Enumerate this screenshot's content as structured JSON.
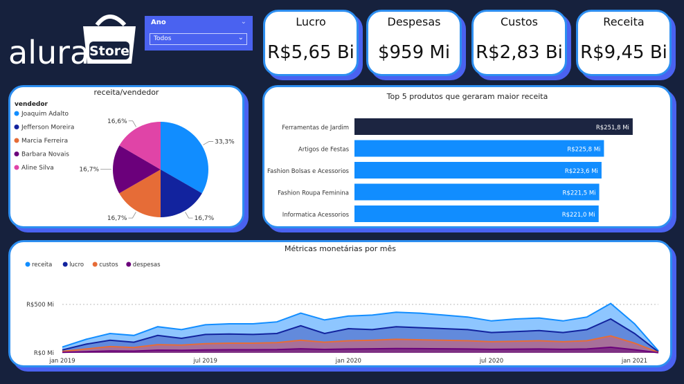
{
  "brand": {
    "name": "alura",
    "store": "Store"
  },
  "slicer": {
    "label": "Ano",
    "value": "Todos"
  },
  "kpis": [
    {
      "title": "Lucro",
      "value": "R$5,65 Bi"
    },
    {
      "title": "Despesas",
      "value": "$959 Mi"
    },
    {
      "title": "Custos",
      "value": "R$2,83 Bi"
    },
    {
      "title": "Receita",
      "value": "R$9,45 Bi"
    }
  ],
  "colors": {
    "background": "#16213d",
    "card_border": "#2d8ef0",
    "card_shadow": "#4a62f0",
    "slicer": "#4a62f0"
  },
  "chart_data": [
    {
      "type": "pie",
      "title": "receita/vendedor",
      "legend_title": "vendedor",
      "legend_position": "left",
      "slices": [
        {
          "name": "Joaquim Adalto",
          "value": 33.3,
          "label": "33,3%",
          "color": "#118dff"
        },
        {
          "name": "Jefferson Moreira",
          "value": 16.7,
          "label": "16,7%",
          "color": "#12239e"
        },
        {
          "name": "Marcia Ferreira",
          "value": 16.7,
          "label": "16,7%",
          "color": "#e66c37"
        },
        {
          "name": "Barbara Novais",
          "value": 16.7,
          "label": "16,7%",
          "color": "#6b007b"
        },
        {
          "name": "Aline Silva",
          "value": 16.6,
          "label": "16,6%",
          "color": "#e044a7"
        }
      ]
    },
    {
      "type": "bar",
      "orientation": "horizontal",
      "title": "Top 5 produtos que geraram maior receita",
      "categories": [
        "Ferramentas de Jardim",
        "Artigos de Festas",
        "Fashion Bolsas e Acessorios",
        "Fashion Roupa Feminina",
        "Informatica Acessorios"
      ],
      "values": [
        251.8,
        225.8,
        223.6,
        221.5,
        221.0
      ],
      "labels": [
        "R$251,8 Mi",
        "R$225,8 Mi",
        "R$223,6 Mi",
        "R$221,5 Mi",
        "R$221,0 Mi"
      ],
      "colors": [
        "#1c2541",
        "#118dff",
        "#118dff",
        "#118dff",
        "#118dff"
      ],
      "xlim": [
        0,
        260
      ]
    },
    {
      "type": "area",
      "title": "Métricas monetárias por mês",
      "legend_position": "top-left",
      "x_ticks": [
        "jan 2019",
        "jul 2019",
        "jan 2020",
        "jul 2020",
        "jan 2021"
      ],
      "y_ticks": [
        "R$0 Mi",
        "R$500 Mi"
      ],
      "ylim": [
        0,
        800
      ],
      "x": [
        "2019-01",
        "2019-02",
        "2019-03",
        "2019-04",
        "2019-05",
        "2019-06",
        "2019-07",
        "2019-08",
        "2019-09",
        "2019-10",
        "2019-11",
        "2019-12",
        "2020-01",
        "2020-02",
        "2020-03",
        "2020-04",
        "2020-05",
        "2020-06",
        "2020-07",
        "2020-08",
        "2020-09",
        "2020-10",
        "2020-11",
        "2020-12",
        "2021-01",
        "2021-02"
      ],
      "series": [
        {
          "name": "receita",
          "color": "#118dff",
          "values": [
            60,
            140,
            200,
            180,
            270,
            240,
            290,
            300,
            300,
            320,
            410,
            340,
            380,
            390,
            420,
            410,
            390,
            370,
            330,
            350,
            360,
            330,
            370,
            510,
            300,
            20
          ]
        },
        {
          "name": "lucro",
          "color": "#12239e",
          "values": [
            30,
            90,
            130,
            110,
            180,
            150,
            190,
            195,
            190,
            200,
            280,
            200,
            250,
            240,
            270,
            260,
            250,
            240,
            210,
            220,
            230,
            210,
            240,
            350,
            200,
            10
          ]
        },
        {
          "name": "custos",
          "color": "#e66c37",
          "values": [
            15,
            40,
            65,
            55,
            85,
            80,
            95,
            100,
            100,
            105,
            130,
            110,
            125,
            130,
            140,
            135,
            130,
            125,
            115,
            120,
            125,
            115,
            125,
            175,
            100,
            5
          ]
        },
        {
          "name": "despesas",
          "color": "#6b007b",
          "values": [
            5,
            12,
            20,
            18,
            28,
            26,
            30,
            32,
            32,
            34,
            42,
            36,
            40,
            42,
            45,
            44,
            42,
            40,
            37,
            38,
            40,
            37,
            40,
            58,
            32,
            2
          ]
        }
      ]
    }
  ]
}
